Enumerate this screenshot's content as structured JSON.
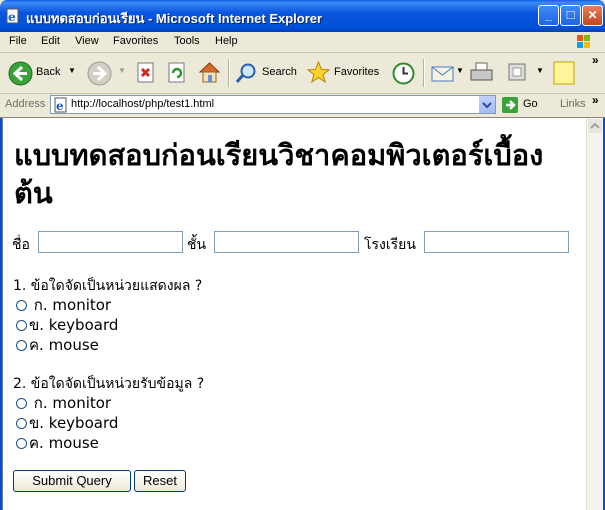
{
  "window": {
    "title": "แบบทดสอบก่อนเรียน - Microsoft Internet Explorer",
    "min_label": "_",
    "max_label": "□",
    "close_label": "✕"
  },
  "menu": [
    "File",
    "Edit",
    "View",
    "Favorites",
    "Tools",
    "Help"
  ],
  "toolbar": {
    "back_label": "Back",
    "search_label": "Search",
    "favorites_label": "Favorites"
  },
  "address": {
    "label": "Address",
    "url": "http://localhost/php/test1.html",
    "go_label": "Go",
    "links_label": "Links"
  },
  "page": {
    "heading": "แบบทดสอบก่อนเรียนวิชาคอมพิวเตอร์เบื้องต้น",
    "fields": {
      "name_label": "ชื่อ",
      "class_label": "ชั้น",
      "school_label": "โรงเรียน",
      "name_value": "",
      "class_value": "",
      "school_value": ""
    },
    "questions": [
      {
        "text": "1. ข้อใดจัดเป็นหน่วยแสดงผล ?",
        "options": [
          "ก. monitor",
          "ข. keyboard",
          "ค. mouse"
        ]
      },
      {
        "text": "2. ข้อใดจัดเป็นหน่วยรับข้อมูล ?",
        "options": [
          "ก. monitor",
          "ข. keyboard",
          "ค. mouse"
        ]
      }
    ],
    "submit_label": "Submit Query",
    "reset_label": "Reset"
  },
  "colors": {
    "titlebar": "#0a55dd",
    "chrome": "#ece9d8",
    "content_bg": "#ffffff"
  }
}
